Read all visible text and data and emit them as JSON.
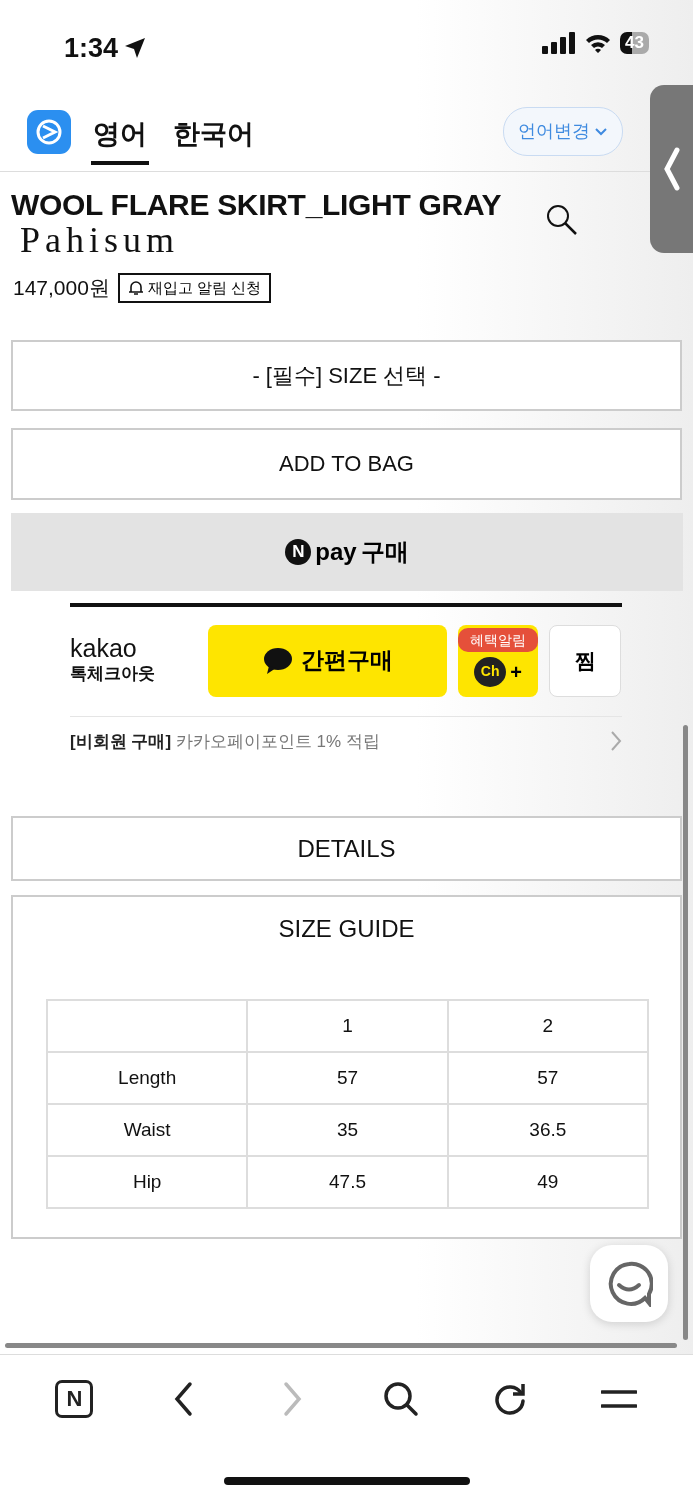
{
  "status_bar": {
    "time": "1:34",
    "battery": "43"
  },
  "translate_bar": {
    "tabs": [
      {
        "label": "영어",
        "selected": true
      },
      {
        "label": "한국어",
        "selected": false
      }
    ],
    "language_button": "언어변경"
  },
  "product": {
    "title": "WOOL FLARE SKIRT_LIGHT GRAY",
    "logo": "Pahisum",
    "price": "147,000원",
    "restock_button": "재입고 알림 신청"
  },
  "size_select": "- [필수] SIZE 선택 -",
  "add_to_bag": "ADD TO BAG",
  "npay": {
    "badge": "N",
    "logo": "pay",
    "label": "구매"
  },
  "kakao": {
    "brand": "kakao",
    "subtitle": "톡체크아웃",
    "buy_button": "간편구매",
    "channel_badge": "혜택알림",
    "channel_label": "Ch",
    "channel_plus": "+",
    "wish_button": "찜",
    "promo": "**[비회원 구매]** 카카오페이포인트 1% 적립"
  },
  "details_button": "DETAILS",
  "size_guide": {
    "title": "SIZE GUIDE",
    "columns": [
      "1",
      "2"
    ],
    "rows": [
      {
        "label": "Length",
        "values": [
          "57",
          "57"
        ]
      },
      {
        "label": "Waist",
        "values": [
          "35",
          "36.5"
        ]
      },
      {
        "label": "Hip",
        "values": [
          "47.5",
          "49"
        ]
      }
    ]
  },
  "toolbar": [
    {
      "kind": "naver",
      "label": "N",
      "disabled": false
    },
    {
      "kind": "back",
      "disabled": false
    },
    {
      "kind": "forward",
      "disabled": true
    },
    {
      "kind": "search",
      "disabled": false
    },
    {
      "kind": "reload",
      "disabled": false
    },
    {
      "kind": "menu",
      "disabled": false
    }
  ]
}
